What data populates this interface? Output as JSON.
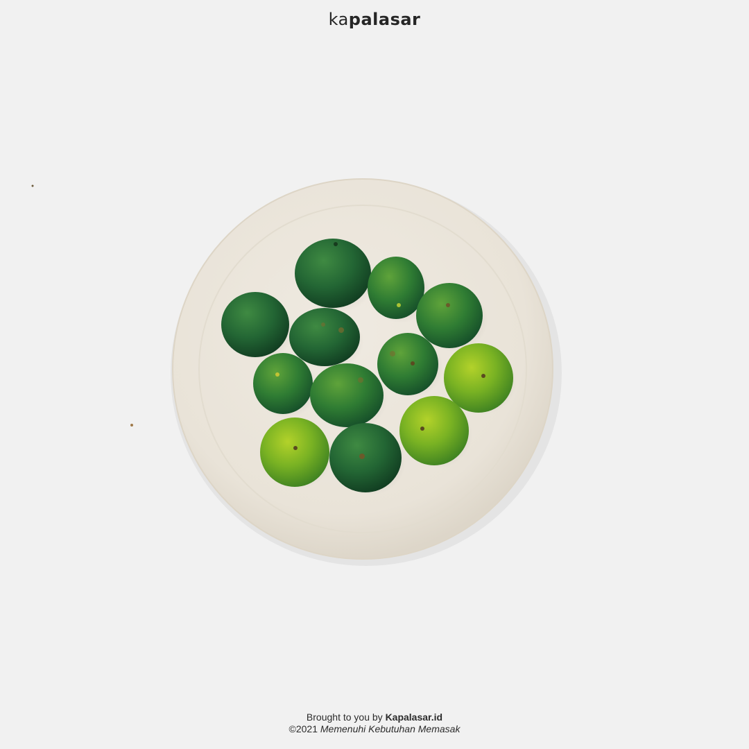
{
  "logo": {
    "part1": "ka",
    "part2": "palasar"
  },
  "footer": {
    "line1_prefix": "Brought to you by",
    "line1_brand": "Kapalasar.id",
    "line2_copyright": "©2021",
    "line2_tagline": "Memenuhi Kebutuhan Memasak"
  },
  "colors": {
    "background": "#f1f1f1",
    "plate": "#ebe6dc",
    "fruit_dark": "#1f5a2c",
    "fruit_mid": "#2e7a34",
    "fruit_light": "#7fb324"
  }
}
